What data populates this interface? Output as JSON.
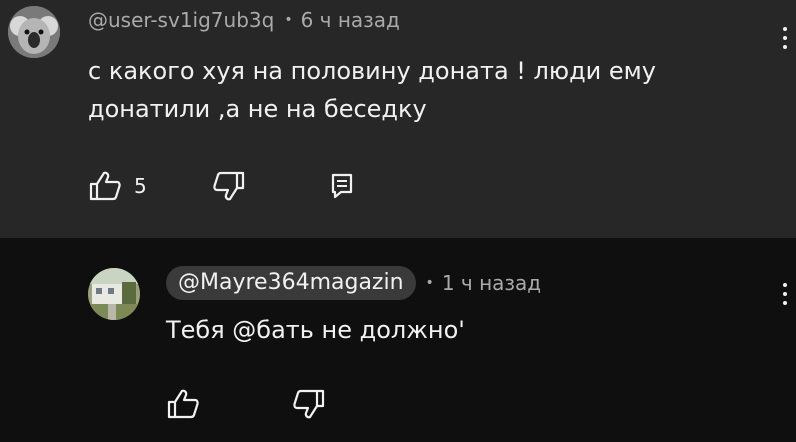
{
  "comments": [
    {
      "author": "@user-sv1ig7ub3q",
      "time": "6 ч назад",
      "text_line1": "с какого хуя на половину доната ! люди ему",
      "text_line2": "донатили ,а не на беседку",
      "likes": "5",
      "avatar_icon": "koala-avatar",
      "like_icon": "thumbs-up-icon",
      "dislike_icon": "thumbs-down-icon",
      "reply_icon": "reply-icon",
      "menu_icon": "more-vert-icon"
    },
    {
      "author": "@Mayre364magazin",
      "time": "1 ч назад",
      "text": "Тебя @бать не должно'",
      "avatar_icon": "house-photo-avatar",
      "like_icon": "thumbs-up-icon",
      "dislike_icon": "thumbs-down-icon",
      "menu_icon": "more-vert-icon"
    }
  ],
  "colors": {
    "top_bg": "#272727",
    "reply_bg": "#0f0f0f",
    "meta": "#aaaaaa",
    "text": "#f1f1f1",
    "chip": "#3a3a3a"
  }
}
